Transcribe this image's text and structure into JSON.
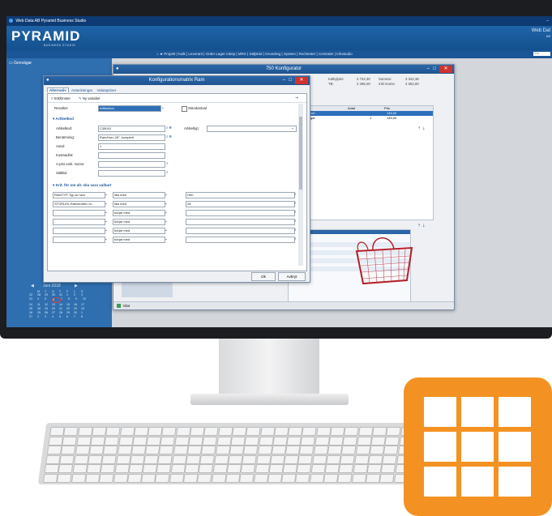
{
  "app": {
    "titlebar_text": "Web Data AB    Pyramid Business Studio",
    "logo": "PYRAMID",
    "logo_sub": "BUSINESS STUDIO",
    "topright_brand": "Web Dat",
    "topright_sub": "AB",
    "menu": [
      "Projekt",
      "Kalk",
      "Leverant",
      "Order Lager Inköp",
      "MRS",
      "Säljstöd",
      "Grundreg",
      "System",
      "Rechenter",
      "Centraler",
      "Infostudio"
    ],
    "search_placeholder": "Sök"
  },
  "sidebar": {
    "nav_label": "Genvägar"
  },
  "calendar": {
    "month": "Juni 2018",
    "weekdays": [
      "M",
      "T",
      "O",
      "T",
      "F",
      "L",
      "S"
    ],
    "weeks": [
      [
        "22",
        "28",
        "29",
        "30",
        "31",
        "1",
        "2",
        "3"
      ],
      [
        "23",
        "4",
        "5",
        "6",
        "7",
        "8",
        "9",
        "10"
      ],
      [
        "24",
        "11",
        "12",
        "13",
        "14",
        "15",
        "16",
        "17"
      ],
      [
        "25",
        "18",
        "19",
        "20",
        "21",
        "22",
        "23",
        "24"
      ],
      [
        "26",
        "25",
        "26",
        "27",
        "28",
        "29",
        "30",
        "1"
      ],
      [
        "27",
        "2",
        "3",
        "4",
        "5",
        "6",
        "7",
        "8"
      ]
    ]
  },
  "back_window": {
    "title": "750 Konfigurator",
    "kalkpris_label": "Kalkylpris:",
    "kalkpris_value": "2 742,30",
    "summa_label": "Summa:",
    "summa_value": "3 342,36",
    "tb_label": "TB:",
    "tb_value": "2 495,00",
    "inkl_moms_label": "Inkl moms:",
    "inkl_moms_value": "4 052,60",
    "col_antal": "Antal",
    "col_pris": "Pris",
    "row1": {
      "text": "nsel",
      "antal": "1",
      "pris": "145,00"
    },
    "row2": {
      "text": "tigal",
      "antal": "1",
      "pris": "145,00"
    },
    "status": "Klar"
  },
  "dialog": {
    "title": "Konfigurationsmatrix Ram",
    "tabs": [
      "Alternativ",
      "Anteckningar",
      "Valutapriser"
    ],
    "toolbar_sok": "Sökfönster",
    "toolbar_ny": "Ny variabel",
    "resultat_label": "Resultat:",
    "resultat_value": "Artikelkod",
    "standardval_label": "Standardval",
    "section_artikelkod": "Artikelkod",
    "fields": [
      {
        "label": "Artikelkod:",
        "value": "C35010"
      },
      {
        "label": "Benämning:",
        "value": "Ram/horn 28\", komplett"
      },
      {
        "label": "Antal:",
        "value": "1"
      },
      {
        "label": "Kostnad/st:",
        "value": ""
      },
      {
        "label": "A-pris exkl. moms:",
        "value": ""
      },
      {
        "label": "Ställtid:",
        "value": ""
      }
    ],
    "artikeltyp_label": "Artikeltyp:",
    "section_krit": "Krit. för om alt. ska vara valbart",
    "criteria": [
      {
        "var": "RAMTYP-Typ av ram",
        "op": "lika med",
        "val": "Herr"
      },
      {
        "var": "STORLEK-Ramstorlek i tu",
        "op": "lika med",
        "val": "28"
      },
      {
        "var": "",
        "op": "börjar med",
        "val": ""
      },
      {
        "var": "",
        "op": "börjar med",
        "val": ""
      },
      {
        "var": "",
        "op": "börjar med",
        "val": ""
      },
      {
        "var": "",
        "op": "börjar med",
        "val": ""
      }
    ],
    "ok_label": "Ok",
    "cancel_label": "Avbryt"
  },
  "colors": {
    "accent": "#1f5a9a",
    "app_icon_orange": "#f39222",
    "close_red": "#d2322d",
    "product_red": "#b3202a"
  },
  "icons": {
    "app_icon": "grid-icon",
    "product": "bicycle-basket-image"
  }
}
